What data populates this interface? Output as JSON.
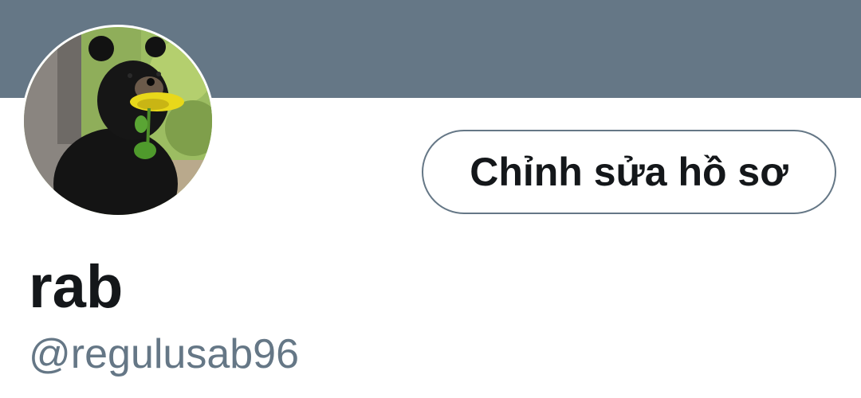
{
  "profile": {
    "banner_color": "#657786",
    "avatar_description_icon": "bear-with-sunflower-photo",
    "edit_button_label": "Chỉnh sửa hồ sơ",
    "display_name": "rab",
    "handle": "@regulusab96"
  },
  "colors": {
    "text_primary": "#14171a",
    "text_secondary": "#657786",
    "border": "#657786"
  }
}
